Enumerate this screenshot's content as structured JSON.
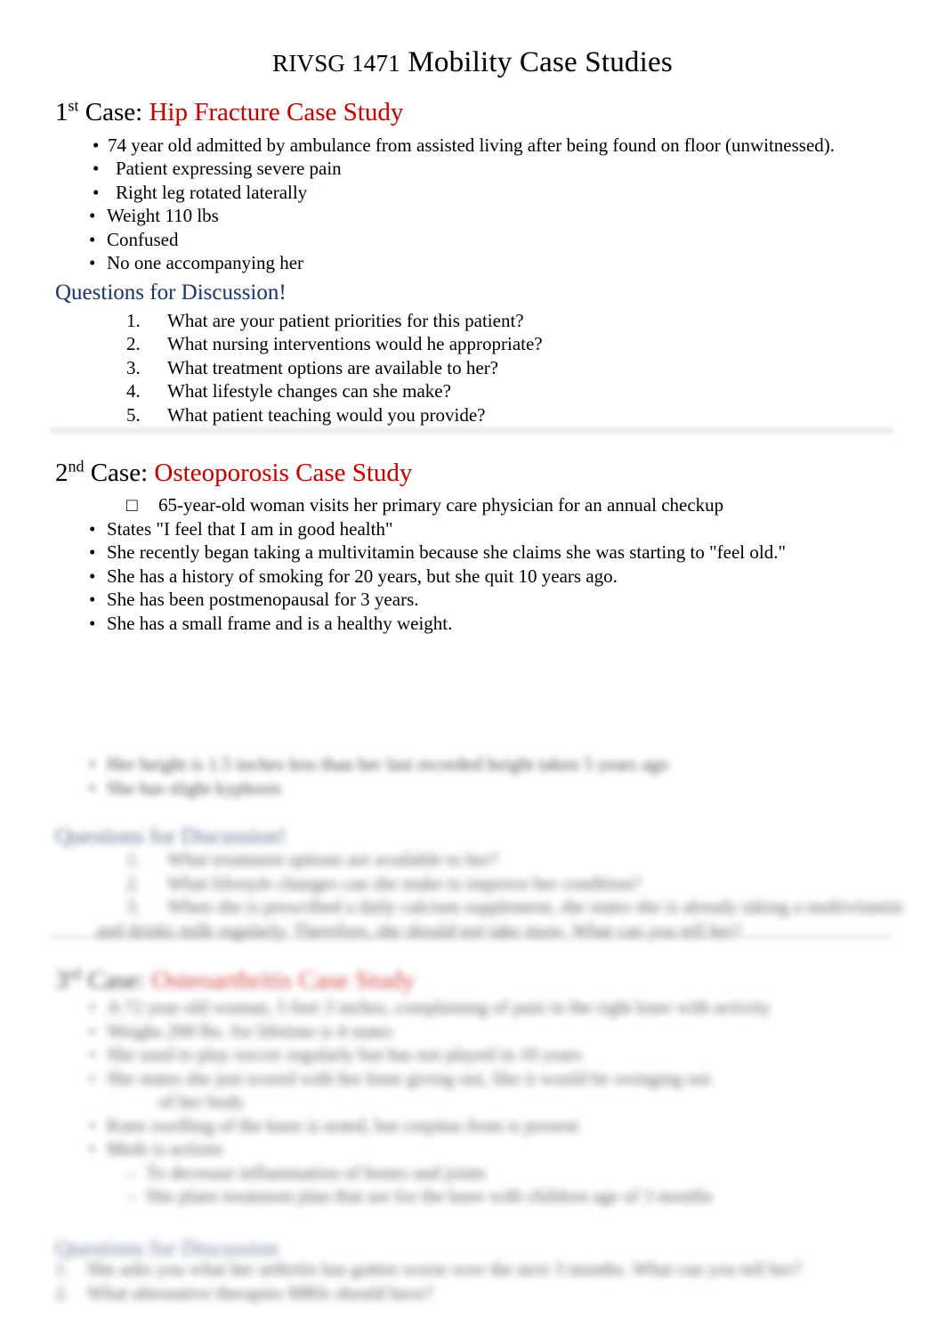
{
  "document": {
    "title_course": "RIVSG 1471",
    "title_main": "Mobility Case Studies"
  },
  "case1": {
    "number": "1",
    "ordinal_suffix": "st",
    "label": " Case: ",
    "title": "Hip Fracture Case Study",
    "title_color": "#C00000",
    "bullets": [
      "74 year old admitted by ambulance from assisted living after being found on floor (unwitnessed).",
      "Patient expressing severe pain",
      "Right leg rotated laterally",
      "Weight 110 lbs",
      "Confused",
      "No one accompanying her"
    ],
    "questions_heading": "Questions for Discussion!",
    "questions_heading_color": "#1F3864",
    "questions": [
      {
        "num": "1.",
        "text": "What are your patient priorities for this patient?"
      },
      {
        "num": "2.",
        "text": "What nursing interventions would he appropriate?"
      },
      {
        "num": "3.",
        "text": "What treatment options are available to her?"
      },
      {
        "num": "4.",
        "text": "What lifestyle changes can she make?"
      },
      {
        "num": "5.",
        "text": "What patient teaching would you provide?"
      }
    ]
  },
  "case2": {
    "number": "2",
    "ordinal_suffix": "nd",
    "label": " Case: ",
    "title": "Osteoporosis Case Study",
    "title_color": "#C00000",
    "bullets": [
      "65-year-old woman visits her primary care physician for an annual checkup",
      "States \"I feel that I am in good health\"",
      "She recently began taking a multivitamin because she claims she was starting to \"feel old.\"",
      "She has a history of smoking for 20 years, but she quit 10 years ago.",
      "She has been postmenopausal for 3 years.",
      "She has a small frame and is a healthy weight."
    ],
    "bullets_blurred": [
      "Her height is 1.5 inches less than her last recorded height taken 5 years ago",
      "She has slight kyphosis"
    ],
    "questions_heading": "Questions for Discussion!",
    "questions_heading_color": "#1F3864",
    "questions": [
      {
        "num": "1.",
        "text": "What treatment options are available to her?"
      },
      {
        "num": "2.",
        "text": "What lifestyle changes can she make to improve her condition?"
      },
      {
        "num": "3.",
        "text": "When she is prescribed a daily calcium supplement, she states she is already taking a multivitamin"
      },
      {
        "num": "",
        "text": "and drinks milk regularly. Therefore, she should not take more. What can you tell her?"
      }
    ]
  },
  "case3": {
    "number": "3",
    "ordinal_suffix": "rd",
    "label": " Case: ",
    "title": "Osteoarthritis Case Study",
    "title_color": "#C00000",
    "bullets": [
      "A 72 year old woman, 5 feet 3 inches, complaining of pain in the right knee with activity",
      "Weighs 200 lbs. for lifetime is 4 states",
      "She used to play soccer regularly but has not played in 10 years",
      "She states she just scored with her knee giving out, like it would be swinging out",
      "of her body",
      "Knee swelling of the knee is noted, but crepitus from is present",
      "Meds is actions",
      "To decrease inflammation of bones and joints",
      "She plans treatment plan that are for the knee with children age of 3 months"
    ],
    "questions_heading": "Questions for Discussion",
    "questions_heading_color": "#1F3864",
    "questions": [
      {
        "num": "1.",
        "text": "She asks you what her arthritis has gotten worse over the next 3 months. What can you tell her?"
      },
      {
        "num": "2.",
        "text": "What alternative therapies MRIs should have?"
      }
    ]
  }
}
